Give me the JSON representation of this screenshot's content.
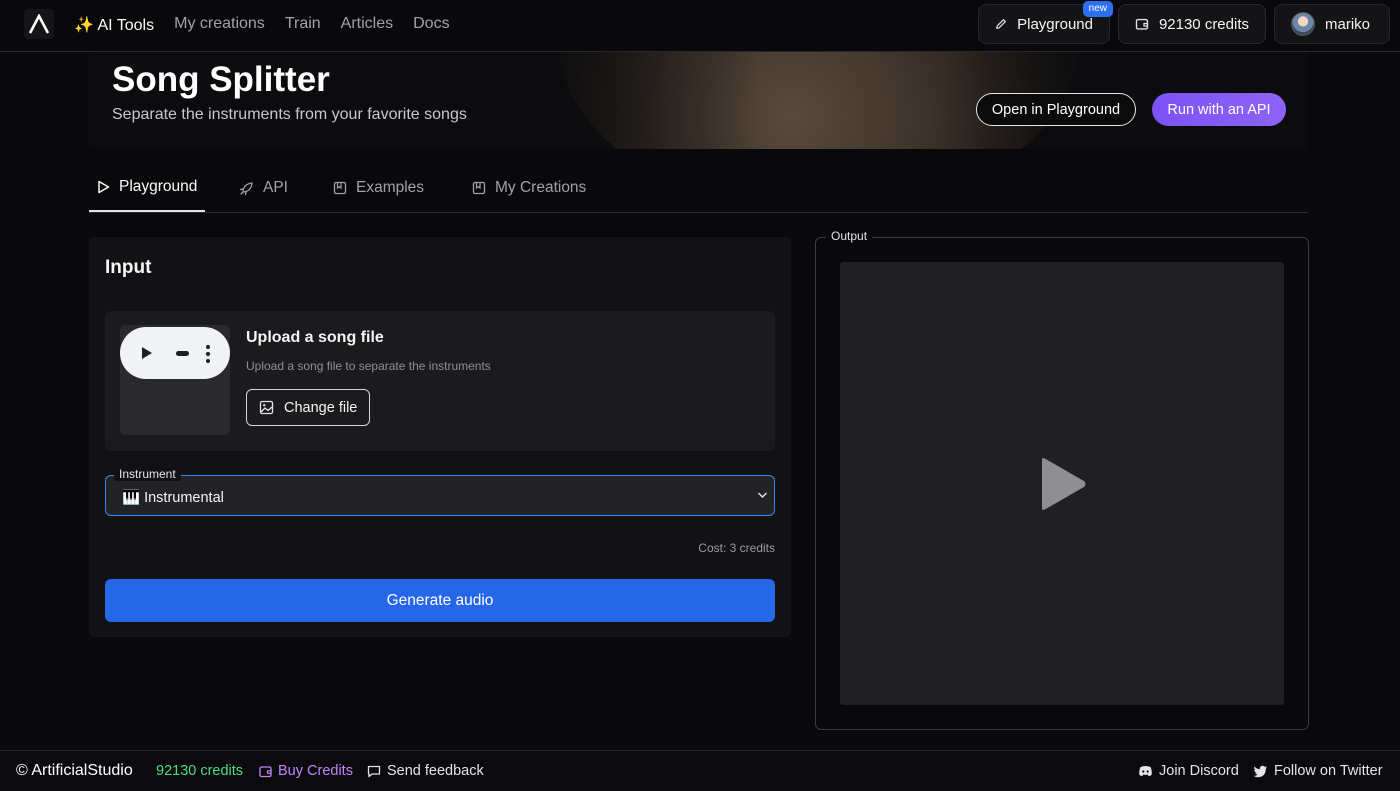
{
  "nav": {
    "links": [
      {
        "label": "✨ AI Tools",
        "active": true
      },
      {
        "label": "My creations"
      },
      {
        "label": "Train"
      },
      {
        "label": "Articles"
      },
      {
        "label": "Docs"
      }
    ],
    "playground_label": "Playground",
    "new_badge": "new",
    "credits_label": "92130 credits",
    "user_name": "mariko"
  },
  "hero": {
    "title": "Song Splitter",
    "subtitle": "Separate the instruments from your favorite songs",
    "open_playground_label": "Open in Playground",
    "run_api_label": "Run with an API"
  },
  "tabs": [
    {
      "label": "Playground",
      "icon": "play-outline-icon",
      "active": true
    },
    {
      "label": "API",
      "icon": "rocket-icon"
    },
    {
      "label": "Examples",
      "icon": "bookmark-icon"
    },
    {
      "label": "My Creations",
      "icon": "bookmark-icon"
    }
  ],
  "input": {
    "title": "Input",
    "upload_title": "Upload a song file",
    "upload_desc": "Upload a song file to separate the instruments",
    "change_file_label": "Change file",
    "instrument_legend": "Instrument",
    "instrument_value": "🎹 Instrumental",
    "cost": "Cost: 3 credits",
    "generate_label": "Generate audio"
  },
  "output": {
    "legend": "Output"
  },
  "footer": {
    "brand": "© ArtificialStudio",
    "credits": "92130 credits",
    "buy_credits": "Buy Credits",
    "send_feedback": "Send feedback",
    "join_discord": "Join Discord",
    "follow_twitter": "Follow on Twitter"
  },
  "colors": {
    "accent_blue": "#2667ea",
    "api_purple": "#7c52f5",
    "credits_green": "#4ade80",
    "buy_purple": "#c084fc"
  }
}
